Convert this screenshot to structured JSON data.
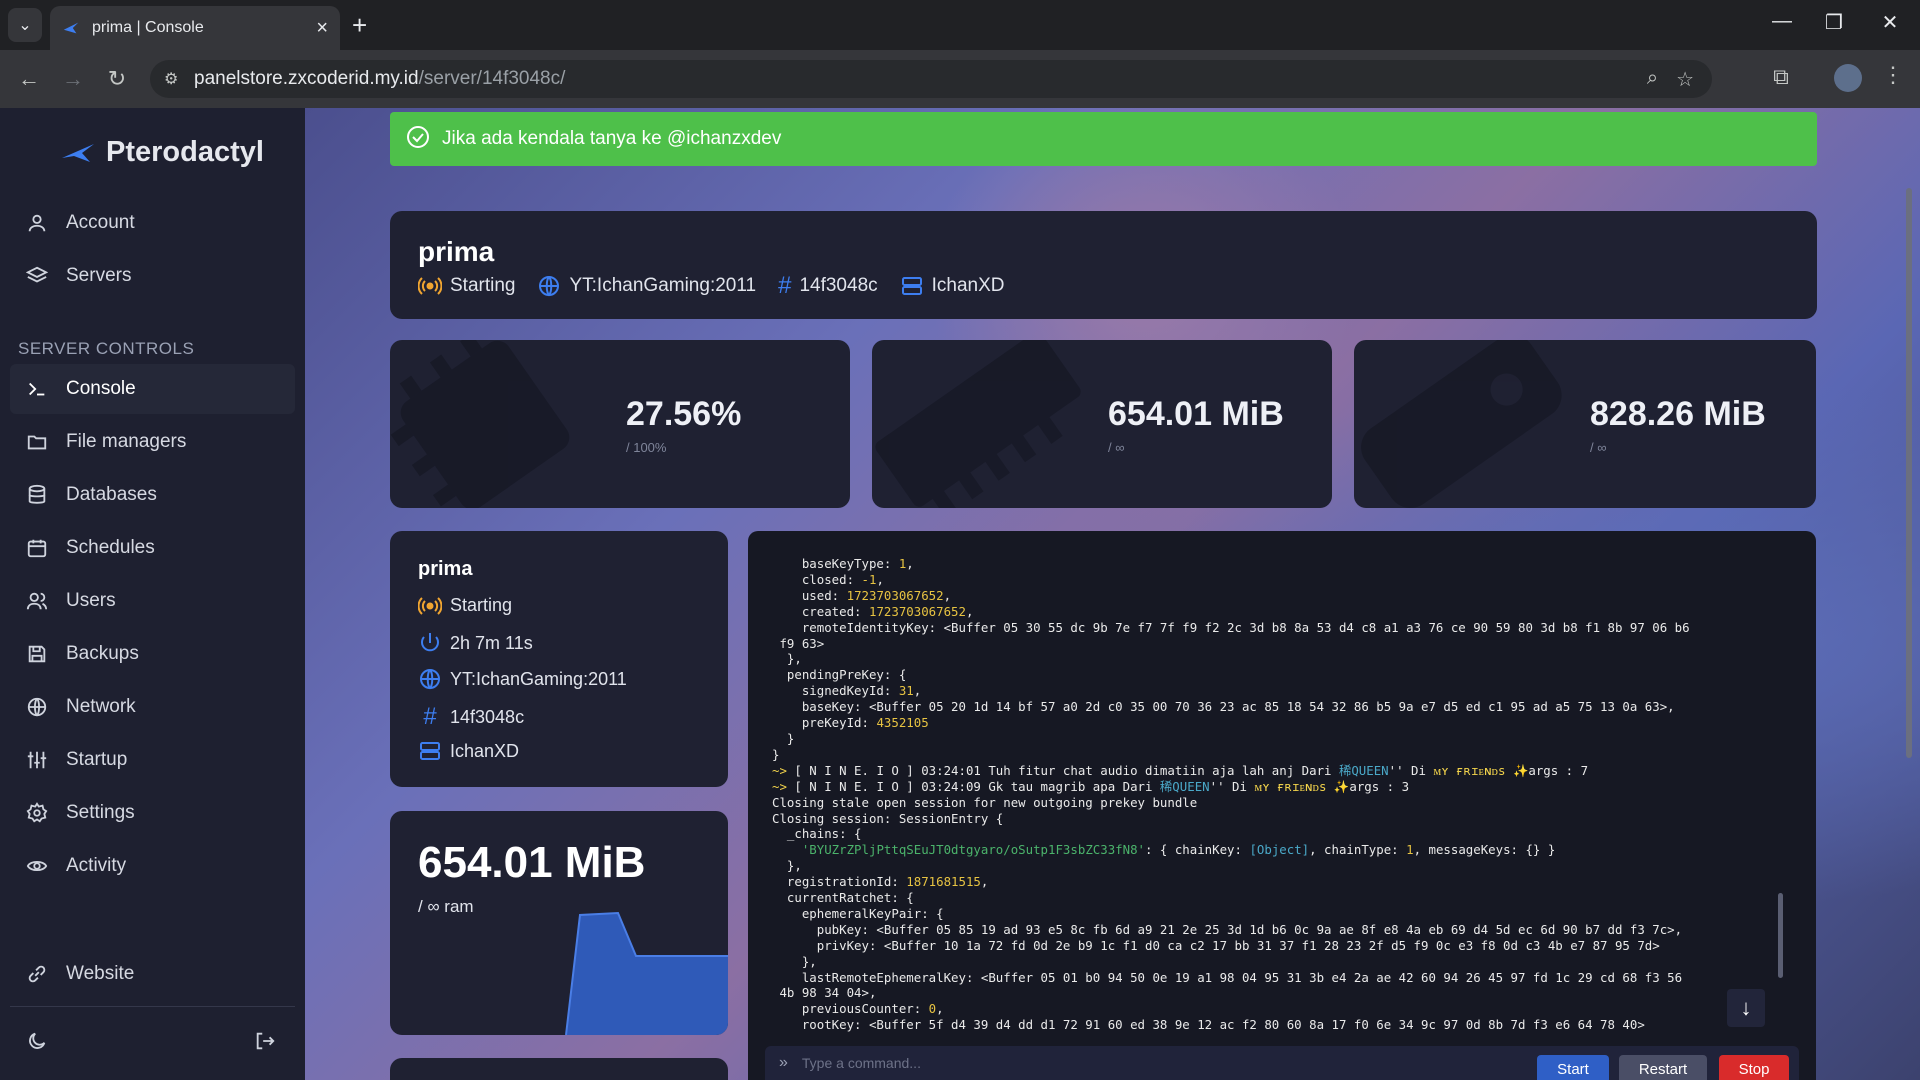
{
  "browser": {
    "tab_title": "prima | Console",
    "url_host": "panelstore.zxcoderid.my.id",
    "url_path": "/server/14f3048c/"
  },
  "sidebar": {
    "brand": "Pterodactyl",
    "items_top": [
      {
        "label": "Account",
        "icon": "user-icon"
      },
      {
        "label": "Servers",
        "icon": "layers-icon"
      }
    ],
    "section_label": "SERVER CONTROLS",
    "items": [
      {
        "label": "Console",
        "icon": "terminal-icon",
        "active": true
      },
      {
        "label": "File managers",
        "icon": "folder-icon"
      },
      {
        "label": "Databases",
        "icon": "database-icon"
      },
      {
        "label": "Schedules",
        "icon": "calendar-icon"
      },
      {
        "label": "Users",
        "icon": "users-icon"
      },
      {
        "label": "Backups",
        "icon": "save-icon"
      },
      {
        "label": "Network",
        "icon": "globe-icon"
      },
      {
        "label": "Startup",
        "icon": "sliders-icon"
      },
      {
        "label": "Settings",
        "icon": "gear-icon"
      },
      {
        "label": "Activity",
        "icon": "eye-icon"
      }
    ],
    "website_label": "Website"
  },
  "alert": {
    "text": "Jika ada kendala tanya ke @ichanzxdev"
  },
  "header": {
    "name": "prima",
    "status": "Starting",
    "address": "YT:IchanGaming:2011",
    "id": "14f3048c",
    "node": "IchanXD"
  },
  "stats": {
    "cpu": {
      "value": "27.56%",
      "limit": "/ 100%"
    },
    "memory": {
      "value": "654.01 MiB",
      "limit": "/ ∞"
    },
    "disk": {
      "value": "828.26 MiB",
      "limit": "/ ∞"
    }
  },
  "info": {
    "name": "prima",
    "status": "Starting",
    "uptime": "2h 7m 11s",
    "address": "YT:IchanGaming:2011",
    "id": "14f3048c",
    "node": "IchanXD"
  },
  "memory_card": {
    "value": "654.01 MiB",
    "sub": "/ ∞ ram"
  },
  "console": {
    "placeholder": "Type a command...",
    "start_label": "Start",
    "restart_label": "Restart",
    "stop_label": "Stop"
  },
  "colors": {
    "alert": "#4ec04a",
    "start": "#2f5fc6",
    "restart": "#4a4e66",
    "stop": "#d92b2b",
    "status": "#f0a531",
    "accent": "#3d7ef0"
  }
}
